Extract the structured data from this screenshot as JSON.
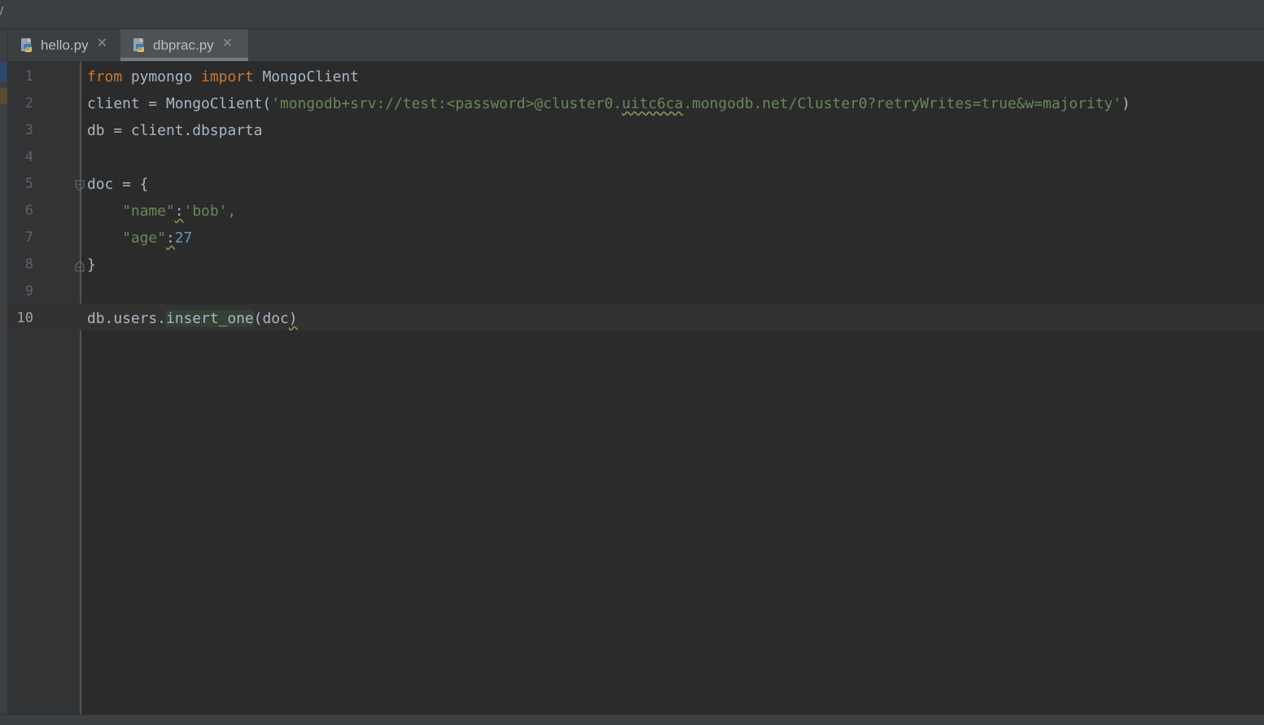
{
  "window": {
    "top_mark": "/"
  },
  "tabs": [
    {
      "label": "hello.py",
      "icon": "python-file-icon",
      "active": false
    },
    {
      "label": "dbprac.py",
      "icon": "python-file-icon",
      "active": true
    }
  ],
  "editor": {
    "current_line": 10,
    "lines": [
      {
        "num": "1",
        "text": "from pymongo import MongoClient"
      },
      {
        "num": "2",
        "text": "client = MongoClient('mongodb+srv://test:<password>@cluster0.uitc6ca.mongodb.net/Cluster0?retryWrites=true&w=majority')"
      },
      {
        "num": "3",
        "text": "db = client.dbsparta"
      },
      {
        "num": "4",
        "text": ""
      },
      {
        "num": "5",
        "text": "doc = {"
      },
      {
        "num": "6",
        "text": "    \"name\":'bob',"
      },
      {
        "num": "7",
        "text": "    \"age\":27"
      },
      {
        "num": "8",
        "text": "}"
      },
      {
        "num": "9",
        "text": ""
      },
      {
        "num": "10",
        "text": "db.users.insert_one(doc)"
      }
    ],
    "tokens": {
      "l1_kw_from": "from",
      "l1_mod": " pymongo ",
      "l1_kw_import": "import",
      "l1_name": " MongoClient",
      "l2_pre": "client = MongoClient(",
      "l2_str_a": "'mongodb+srv://test:<password>@cluster0.",
      "l2_str_b": "uitc6ca",
      "l2_str_c": ".mongodb.net/Cluster0?retryWrites=true&w=majority'",
      "l2_post": ")",
      "l3": "db = client.dbsparta",
      "l5": "doc = {",
      "l6_indent": "    ",
      "l6_key": "\"name\"",
      "l6_colon": ":",
      "l6_val": "'bob',",
      "l7_indent": "    ",
      "l7_key": "\"age\"",
      "l7_colon": ":",
      "l7_val": "27",
      "l8": "}",
      "l10_pre": "db.users.",
      "l10_fn": "insert_one",
      "l10_arg": "(doc",
      "l10_close": ")"
    }
  },
  "colors": {
    "background": "#2b2b2b",
    "keyword": "#cc7832",
    "string": "#6a8759",
    "number": "#6897bb",
    "text": "#a9b7c6"
  }
}
